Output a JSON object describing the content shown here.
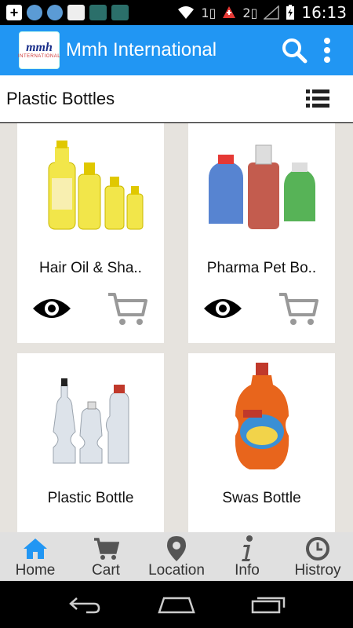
{
  "status_bar": {
    "time": "16:13",
    "sim1_label": "1",
    "sim2_label": "2",
    "left_icons": [
      "add-icon",
      "sync-icon",
      "sync-icon",
      "app-thumbnail-icon",
      "app-thumbnail-icon",
      "app-thumbnail-icon"
    ],
    "right_icons": [
      "wifi-icon",
      "sim1-icon",
      "alert-icon",
      "sim2-icon",
      "signal-icon",
      "battery-icon"
    ]
  },
  "app_bar": {
    "logo_text": "mmh",
    "logo_subtext": "INTERNATIONAL",
    "title": "Mmh International",
    "accent_color": "#2196f3"
  },
  "section": {
    "title": "Plastic Bottles"
  },
  "products": [
    {
      "name": "Hair Oil & Sha..",
      "image": "hair-oil-bottles"
    },
    {
      "name": "Pharma Pet Bo..",
      "image": "pharma-pet-bottles"
    },
    {
      "name": "Plastic Bottle",
      "image": "plastic-bottles"
    },
    {
      "name": "Swas Bottle",
      "image": "swas-bottle"
    }
  ],
  "bottom_nav": [
    {
      "label": "Home",
      "icon": "home-icon",
      "active": true
    },
    {
      "label": "Cart",
      "icon": "cart-icon"
    },
    {
      "label": "Location",
      "icon": "location-pin-icon"
    },
    {
      "label": "Info",
      "icon": "info-icon"
    },
    {
      "label": "Histroy",
      "icon": "clock-icon"
    }
  ],
  "colors": {
    "active_nav": "#2196f3",
    "inactive_nav": "#555555",
    "grid_bg": "#e6e3de"
  }
}
